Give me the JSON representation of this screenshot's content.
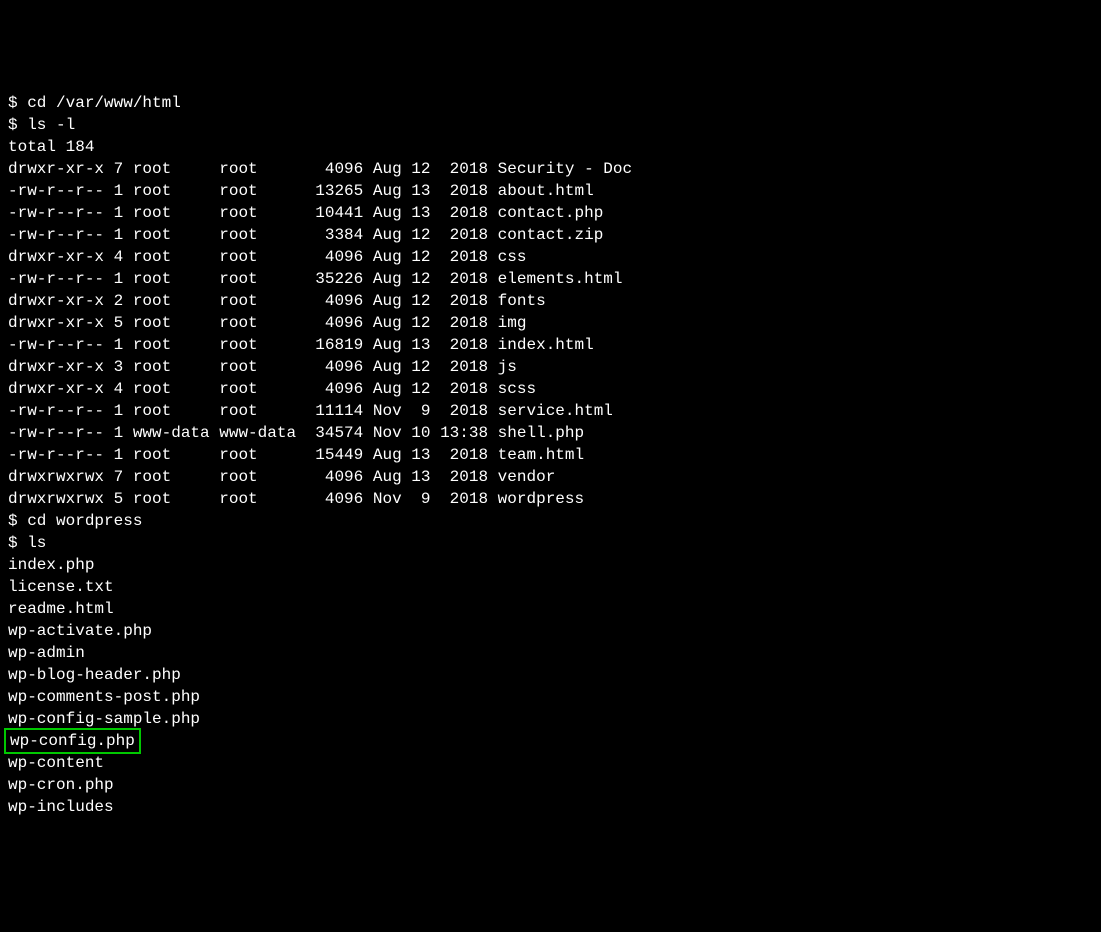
{
  "prompt": "$",
  "cmd_cd_html": "cd /var/www/html",
  "cmd_ls_l": "ls -l",
  "total_line": "total 184",
  "ls_l_rows": [
    {
      "perm": "drwxr-xr-x",
      "links": "7",
      "owner": "root    ",
      "group": "root    ",
      "size": "  4096",
      "date": "Aug 12  2018",
      "name": "Security - Doc"
    },
    {
      "perm": "-rw-r--r--",
      "links": "1",
      "owner": "root    ",
      "group": "root    ",
      "size": " 13265",
      "date": "Aug 13  2018",
      "name": "about.html"
    },
    {
      "perm": "-rw-r--r--",
      "links": "1",
      "owner": "root    ",
      "group": "root    ",
      "size": " 10441",
      "date": "Aug 13  2018",
      "name": "contact.php"
    },
    {
      "perm": "-rw-r--r--",
      "links": "1",
      "owner": "root    ",
      "group": "root    ",
      "size": "  3384",
      "date": "Aug 12  2018",
      "name": "contact.zip"
    },
    {
      "perm": "drwxr-xr-x",
      "links": "4",
      "owner": "root    ",
      "group": "root    ",
      "size": "  4096",
      "date": "Aug 12  2018",
      "name": "css"
    },
    {
      "perm": "-rw-r--r--",
      "links": "1",
      "owner": "root    ",
      "group": "root    ",
      "size": " 35226",
      "date": "Aug 12  2018",
      "name": "elements.html"
    },
    {
      "perm": "drwxr-xr-x",
      "links": "2",
      "owner": "root    ",
      "group": "root    ",
      "size": "  4096",
      "date": "Aug 12  2018",
      "name": "fonts"
    },
    {
      "perm": "drwxr-xr-x",
      "links": "5",
      "owner": "root    ",
      "group": "root    ",
      "size": "  4096",
      "date": "Aug 12  2018",
      "name": "img"
    },
    {
      "perm": "-rw-r--r--",
      "links": "1",
      "owner": "root    ",
      "group": "root    ",
      "size": " 16819",
      "date": "Aug 13  2018",
      "name": "index.html"
    },
    {
      "perm": "drwxr-xr-x",
      "links": "3",
      "owner": "root    ",
      "group": "root    ",
      "size": "  4096",
      "date": "Aug 12  2018",
      "name": "js"
    },
    {
      "perm": "drwxr-xr-x",
      "links": "4",
      "owner": "root    ",
      "group": "root    ",
      "size": "  4096",
      "date": "Aug 12  2018",
      "name": "scss"
    },
    {
      "perm": "-rw-r--r--",
      "links": "1",
      "owner": "root    ",
      "group": "root    ",
      "size": " 11114",
      "date": "Nov  9  2018",
      "name": "service.html"
    },
    {
      "perm": "-rw-r--r--",
      "links": "1",
      "owner": "www-data",
      "group": "www-data",
      "size": " 34574",
      "date": "Nov 10 13:38",
      "name": "shell.php"
    },
    {
      "perm": "-rw-r--r--",
      "links": "1",
      "owner": "root    ",
      "group": "root    ",
      "size": " 15449",
      "date": "Aug 13  2018",
      "name": "team.html"
    },
    {
      "perm": "drwxrwxrwx",
      "links": "7",
      "owner": "root    ",
      "group": "root    ",
      "size": "  4096",
      "date": "Aug 13  2018",
      "name": "vendor"
    },
    {
      "perm": "drwxrwxrwx",
      "links": "5",
      "owner": "root    ",
      "group": "root    ",
      "size": "  4096",
      "date": "Nov  9  2018",
      "name": "wordpress"
    }
  ],
  "cmd_cd_wp": "cd wordpress",
  "cmd_ls": "ls",
  "ls_rows": [
    "index.php",
    "license.txt",
    "readme.html",
    "wp-activate.php",
    "wp-admin",
    "wp-blog-header.php",
    "wp-comments-post.php",
    "wp-config-sample.php"
  ],
  "highlighted": "wp-config.php",
  "after_highlight": [
    "wp-content",
    "wp-cron.php",
    "wp-includes"
  ]
}
